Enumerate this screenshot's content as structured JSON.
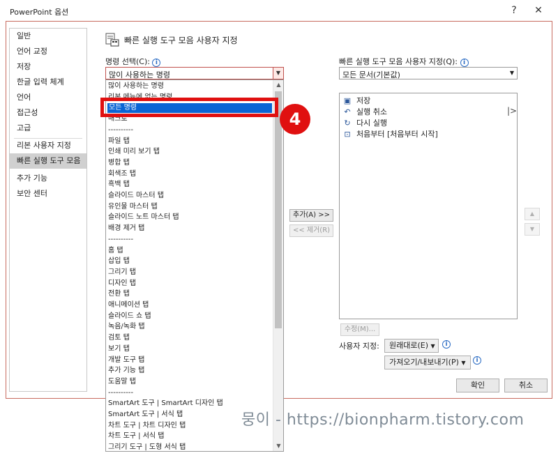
{
  "window": {
    "title": "PowerPoint 옵션",
    "help": "?",
    "close": "✕"
  },
  "nav": {
    "items": [
      {
        "label": "일반"
      },
      {
        "label": "언어 교정"
      },
      {
        "label": "저장"
      },
      {
        "label": "한글 입력 체계"
      },
      {
        "label": "언어"
      },
      {
        "label": "접근성"
      },
      {
        "label": "고급"
      },
      {
        "label": "리본 사용자 지정"
      },
      {
        "label": "빠른 실행 도구 모음"
      },
      {
        "label": "추가 기능"
      },
      {
        "label": "보안 센터"
      }
    ],
    "selected": "빠른 실행 도구 모음"
  },
  "header": {
    "title": "빠른 실행 도구 모음 사용자 지정"
  },
  "left": {
    "label": "명령 선택(C):",
    "combo_value": "많이 사용하는 명령",
    "dropdown_items": [
      "많이 사용하는 명령",
      "리본 메뉴에 없는 명령",
      "모든 명령",
      "매크로",
      "----------",
      "파일 탭",
      "인쇄 미리 보기 탭",
      "병합 탭",
      "회색조 탭",
      "흑백 탭",
      "슬라이드 마스터 탭",
      "유인물 마스터 탭",
      "슬라이드 노트 마스터 탭",
      "배경 제거 탭",
      "----------",
      "홈 탭",
      "삽입 탭",
      "그리기 탭",
      "디자인 탭",
      "전환 탭",
      "애니메이션 탭",
      "슬라이드 쇼 탭",
      "녹음/녹화 탭",
      "검토 탭",
      "보기 탭",
      "개발 도구 탭",
      "추가 기능 탭",
      "도움말 탭",
      "----------",
      "SmartArt 도구 | SmartArt 디자인 탭",
      "SmartArt 도구 | 서식 탭",
      "차트 도구 | 차트 디자인 탭",
      "차트 도구 | 서식 탭",
      "그리기 도구 | 도형 서식 탭"
    ],
    "highlighted": "모든 명령"
  },
  "middle": {
    "add": "추가(A) >>",
    "remove": "<< 제거(R)"
  },
  "right": {
    "label": "빠른 실행 도구 모음 사용자 지정(Q):",
    "combo_value": "모든 문서(기본값)",
    "items": [
      {
        "icon": "save-icon",
        "label": "저장"
      },
      {
        "icon": "undo-icon",
        "label": "실행 취소"
      },
      {
        "icon": "redo-icon",
        "label": "다시 실행"
      },
      {
        "icon": "slideshow-start-icon",
        "label": "처음부터 [처음부터 시작]"
      }
    ],
    "separator": "|>",
    "modify": "수정(M)...",
    "customize_label": "사용자 지정:",
    "reset": "원래대로(E)",
    "import_export": "가져오기/내보내기(P)"
  },
  "footer": {
    "ok": "확인",
    "cancel": "취소"
  },
  "annotation": {
    "step": "4"
  },
  "watermark": "뭉이 - https://bionpharm.tistory.com"
}
